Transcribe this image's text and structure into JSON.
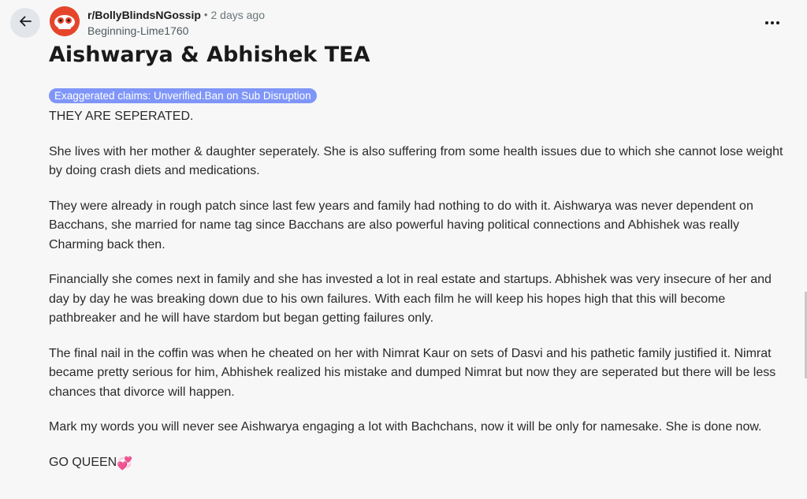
{
  "header": {
    "back_icon": "arrow-left-icon",
    "subreddit": "r/BollyBlindsNGossip",
    "separator": "•",
    "time": "2 days ago",
    "author": "Beginning-Lime1760",
    "more_icon": "ellipsis-horizontal-icon"
  },
  "post": {
    "title": "Aishwarya & Abhishek TEA",
    "flair": "Exaggerated claims: Unverified.Ban on Sub Disruption",
    "flair_color": "#7f96f8",
    "paragraphs": [
      "THEY ARE SEPERATED.",
      "She lives with her mother & daughter seperately. She is also suffering from some health issues due to which she cannot lose weight by doing crash diets and medications.",
      "They were already in rough patch since last few years and family had nothing to do with it. Aishwarya was never dependent on Bacchans, she married for name tag since Bacchans are also powerful having political connections and Abhishek was really Charming back then.",
      "Financially she comes next in family and she has invested a lot in real estate and startups. Abhishek was very insecure of her and day by day he was breaking down due to his own failures. With each film he will keep his hopes high that this will become pathbreaker and he will have stardom but began getting failures only.",
      "The final nail in the coffin was when he cheated on her with Nimrat Kaur on sets of Dasvi and his pathetic family justified it. Nimrat became pretty serious for him, Abhishek realized his mistake and dumped Nimrat but now they are seperated but there will be less chances that divorce will happen.",
      "Mark my words you will never see Aishwarya engaging a lot with Bachchans, now it will be only for namesake. She is done now.",
      "GO QUEEN"
    ],
    "closing_emoji": "💞"
  }
}
